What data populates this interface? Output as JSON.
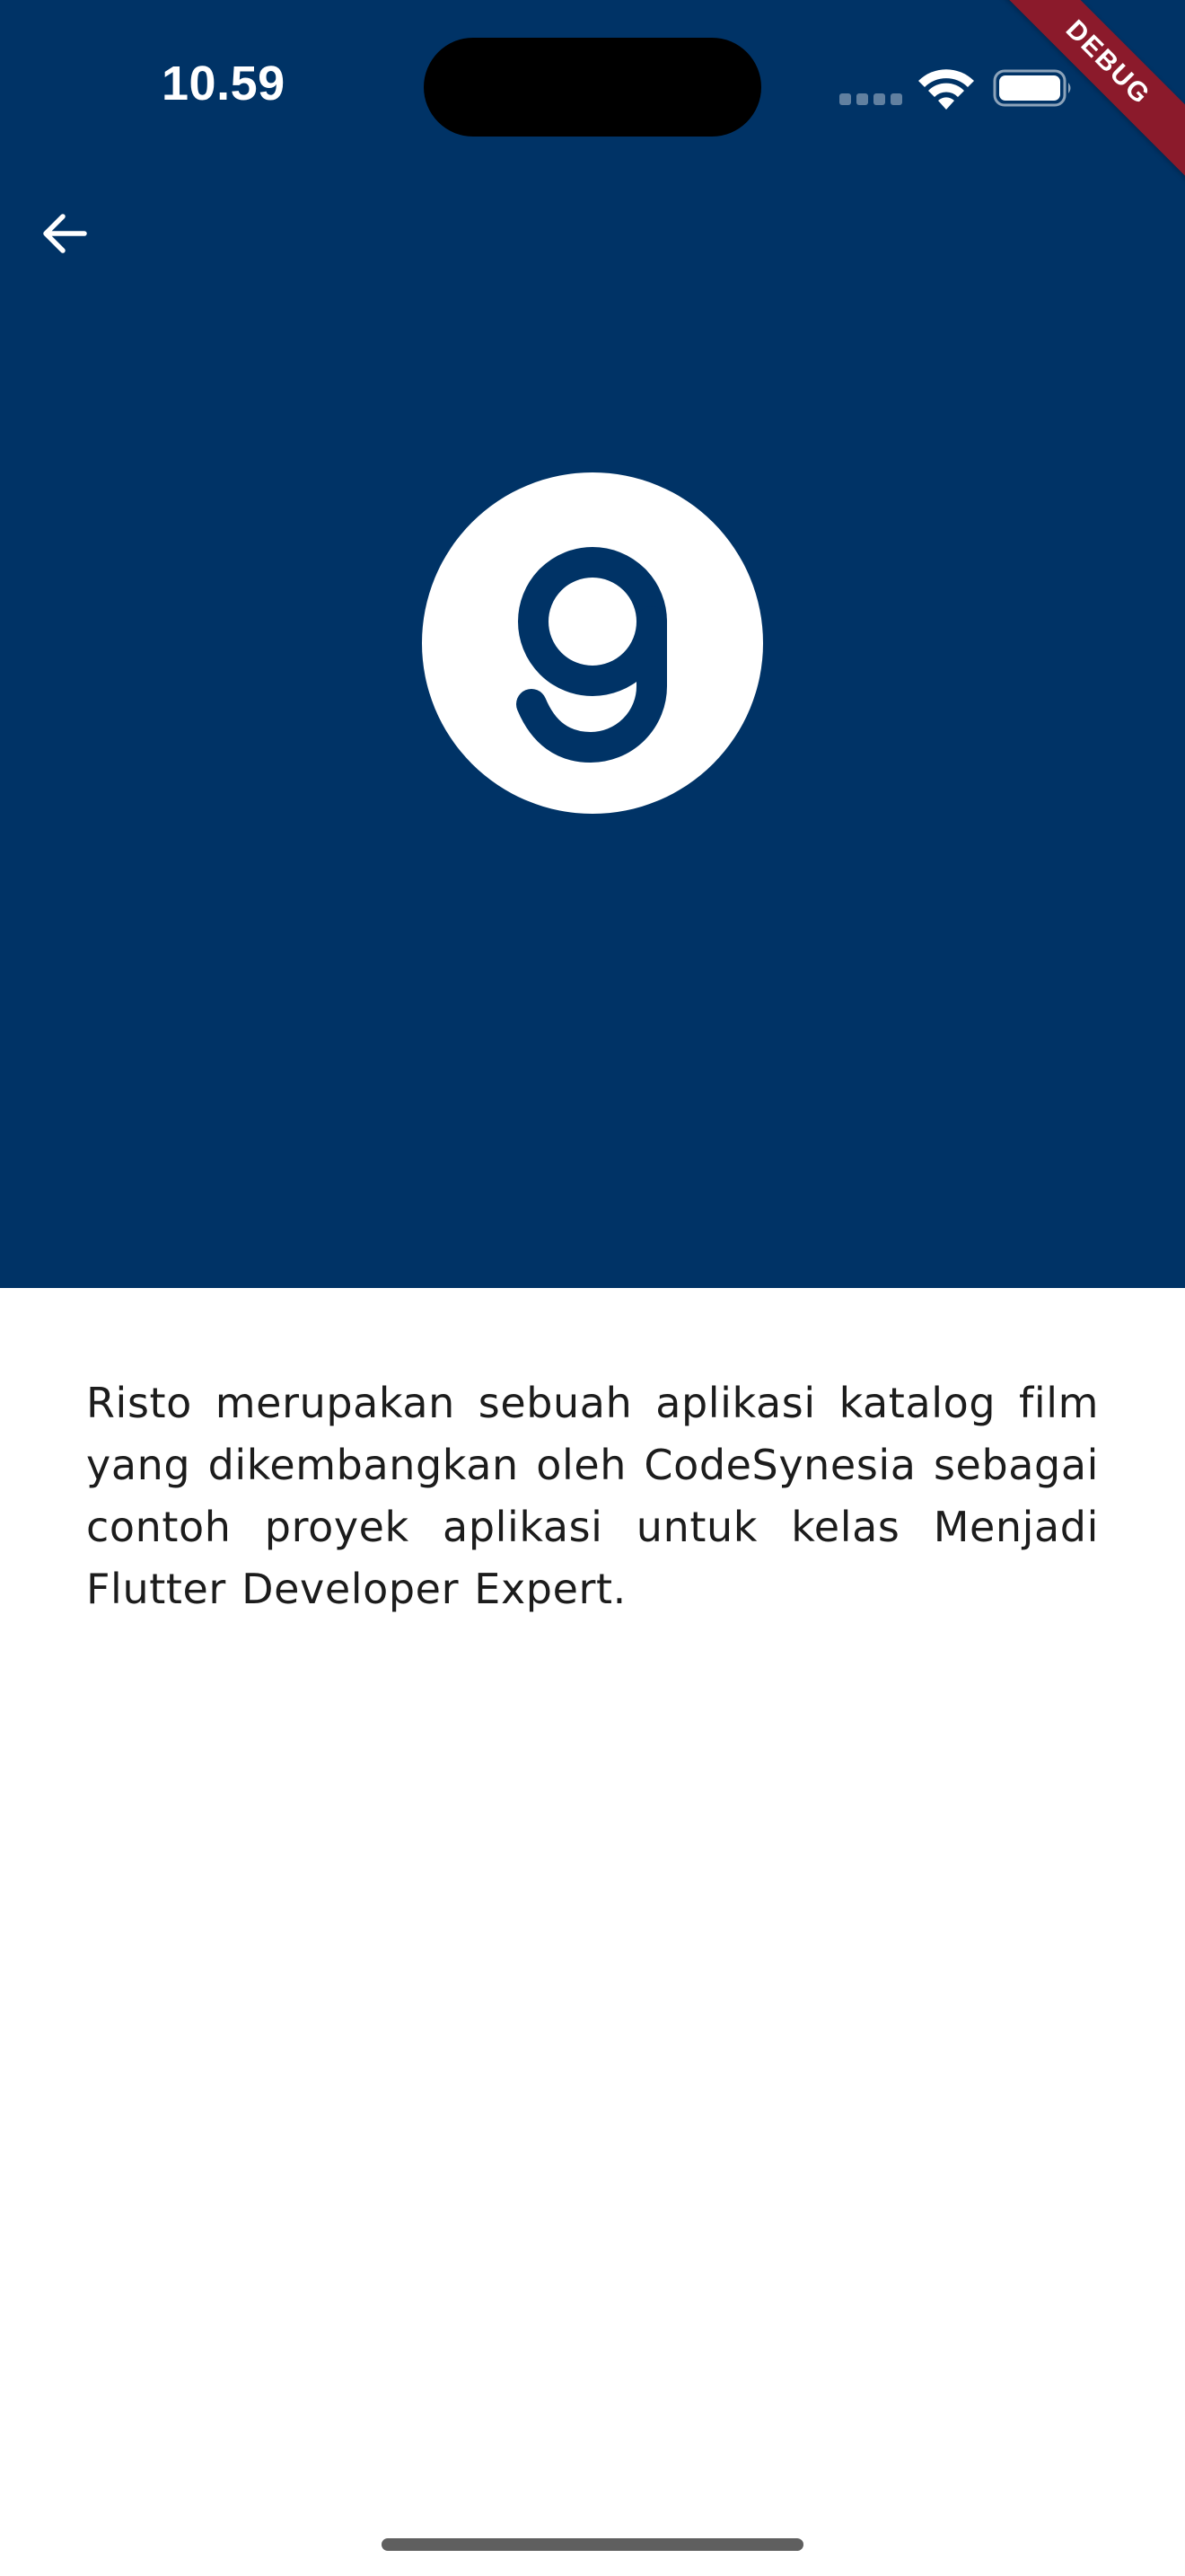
{
  "status_bar": {
    "time": "10.59"
  },
  "debug_banner": {
    "label": "DEBUG"
  },
  "header": {
    "back_icon": "arrow-left-icon"
  },
  "logo": {
    "icon": "g-logo-icon",
    "colors": {
      "background": "#003366",
      "circle": "#ffffff",
      "glyph": "#003366"
    }
  },
  "about": {
    "description": "Risto merupakan sebuah aplikasi katalog film yang dikembangkan oleh CodeSynesia sebagai contoh proyek aplikasi untuk kelas Menjadi Flutter Developer Expert."
  },
  "colors": {
    "primary": "#003366",
    "debug": "#8b1a2b",
    "text": "#1c1c1c"
  }
}
